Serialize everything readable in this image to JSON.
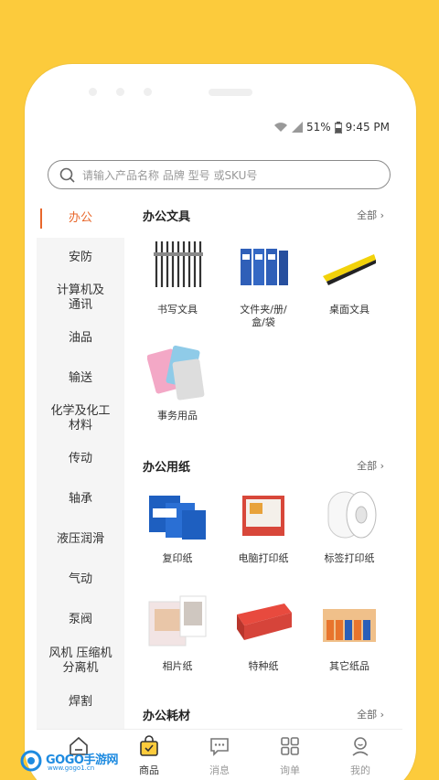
{
  "status": {
    "battery": "51%",
    "time": "9:45 PM"
  },
  "search": {
    "placeholder": "请输入产品名称 品牌 型号 或SKU号"
  },
  "sidebar": {
    "items": [
      {
        "label": "办公",
        "active": true
      },
      {
        "label": "安防"
      },
      {
        "label": "计算机及通讯"
      },
      {
        "label": "油品"
      },
      {
        "label": "输送"
      },
      {
        "label": "化学及化工材料"
      },
      {
        "label": "传动"
      },
      {
        "label": "轴承"
      },
      {
        "label": "液压润滑"
      },
      {
        "label": "气动"
      },
      {
        "label": "泵阀"
      },
      {
        "label": "风机 压缩机 分离机"
      },
      {
        "label": "焊割"
      }
    ]
  },
  "sections": [
    {
      "title": "办公文具",
      "all": "全部",
      "products": [
        {
          "label": "书写文具"
        },
        {
          "label": "文件夹/册/盒/袋"
        },
        {
          "label": "桌面文具"
        },
        {
          "label": "事务用品"
        }
      ]
    },
    {
      "title": "办公用纸",
      "all": "全部",
      "products": [
        {
          "label": "复印纸"
        },
        {
          "label": "电脑打印纸"
        },
        {
          "label": "标签打印纸"
        },
        {
          "label": "相片纸"
        },
        {
          "label": "特种纸"
        },
        {
          "label": "其它纸品"
        }
      ]
    },
    {
      "title": "办公耗材",
      "all": "全部"
    }
  ],
  "tabbar": {
    "items": [
      {
        "label": ""
      },
      {
        "label": "商品"
      },
      {
        "label": "消息"
      },
      {
        "label": "询单"
      },
      {
        "label": "我的"
      }
    ]
  },
  "watermark": {
    "text": "GOGO手游网",
    "sub": "www.gogo1.cn"
  },
  "colors": {
    "background": "#FCCB3C",
    "accent": "#E8672B",
    "sidebar_bg": "#F5F5F5"
  }
}
